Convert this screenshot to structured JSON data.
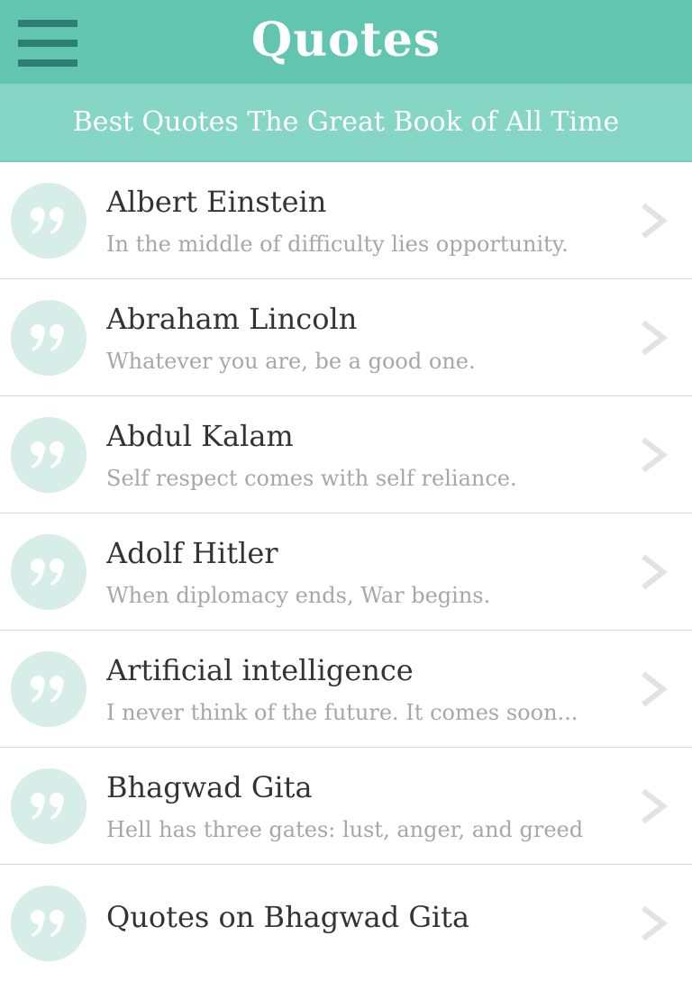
{
  "header": {
    "title": "Quotes",
    "subtitle": "Best Quotes The Great Book of All Time",
    "menu_icon": "hamburger-menu-icon"
  },
  "colors": {
    "header_bg": "#62c5b0",
    "subtitle_bg": "#86d6c5",
    "menu_icon": "#2e7e71",
    "quote_circle": "#d6ede8"
  },
  "list": {
    "items": [
      {
        "name": "Albert Einstein",
        "quote": "In the middle of difficulty lies opportunity."
      },
      {
        "name": "Abraham Lincoln",
        "quote": "Whatever you are, be a good one."
      },
      {
        "name": "Abdul Kalam",
        "quote": "Self respect comes with self reliance."
      },
      {
        "name": "Adolf Hitler",
        "quote": "When diplomacy ends, War begins."
      },
      {
        "name": "Artificial intelligence",
        "quote": "I never think of the future. It comes soon..."
      },
      {
        "name": "Bhagwad Gita",
        "quote": "Hell has three gates: lust, anger, and greed"
      },
      {
        "name": "Quotes on Bhagwad Gita",
        "quote": ""
      }
    ]
  }
}
